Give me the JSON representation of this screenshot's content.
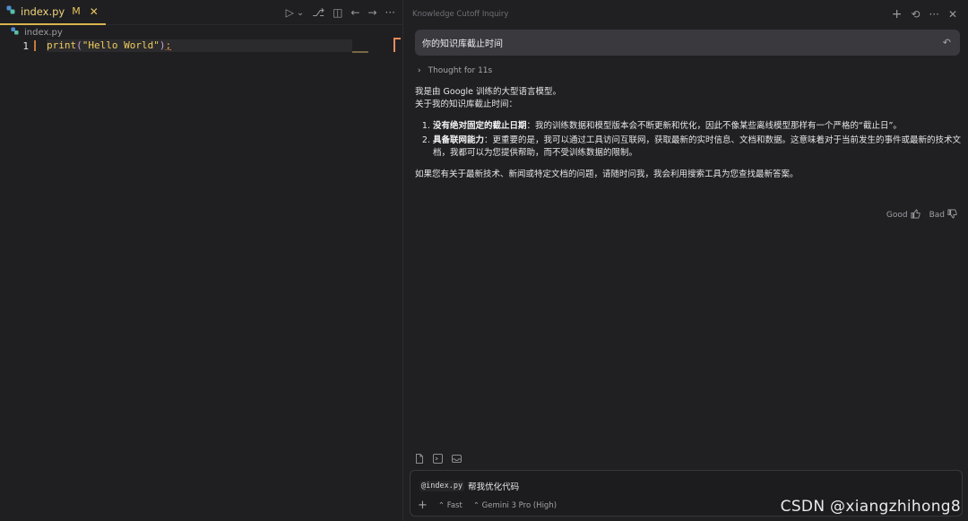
{
  "editor": {
    "tab": {
      "label": "index.py",
      "status": "M",
      "icon": "python-icon",
      "close": "✕"
    },
    "actions": {
      "run": "▷",
      "run_menu": "⌄",
      "diff": "⎇",
      "split": "◫",
      "back": "←",
      "forward": "→",
      "more": "···"
    },
    "breadcrumb": {
      "file": "index.py"
    },
    "code": {
      "line_number": "1",
      "fn": "print",
      "open_paren": "(",
      "string": "\"Hello World\"",
      "close_paren": ")",
      "semicolon": ";"
    }
  },
  "chat": {
    "title": "Knowledge Cutoff Inquiry",
    "header_actions": {
      "new": "+",
      "history": "⟲",
      "more": "···",
      "close": "✕"
    },
    "user_message": "你的知识库截止时间",
    "revert_icon": "↶",
    "thought_label": "Thought for 11s",
    "answer": {
      "intro_1": "我是由 Google 训练的大型语言模型。",
      "intro_2": "关于我的知识库截止时间：",
      "items": [
        {
          "bold": "没有绝对固定的截止日期",
          "text": "：我的训练数据和模型版本会不断更新和优化，因此不像某些离线模型那样有一个严格的“截止日”。"
        },
        {
          "bold": "具备联网能力",
          "text": "：更重要的是，我可以通过工具访问互联网，获取最新的实时信息、文档和数据。这意味着对于当前发生的事件或最新的技术文档，我都可以为您提供帮助，而不受训练数据的限制。"
        }
      ],
      "closing": "如果您有关于最新技术、新闻或特定文档的问题，请随时问我，我会利用搜索工具为您查找最新答案。"
    },
    "feedback": {
      "good": "Good",
      "bad": "Bad"
    },
    "composer": {
      "mention": "@index.py",
      "text": "帮我优化代码",
      "plus": "+",
      "mode": "Fast",
      "model": "Gemini 3 Pro (High)"
    }
  },
  "watermark": "CSDN @xiangzhihong8"
}
